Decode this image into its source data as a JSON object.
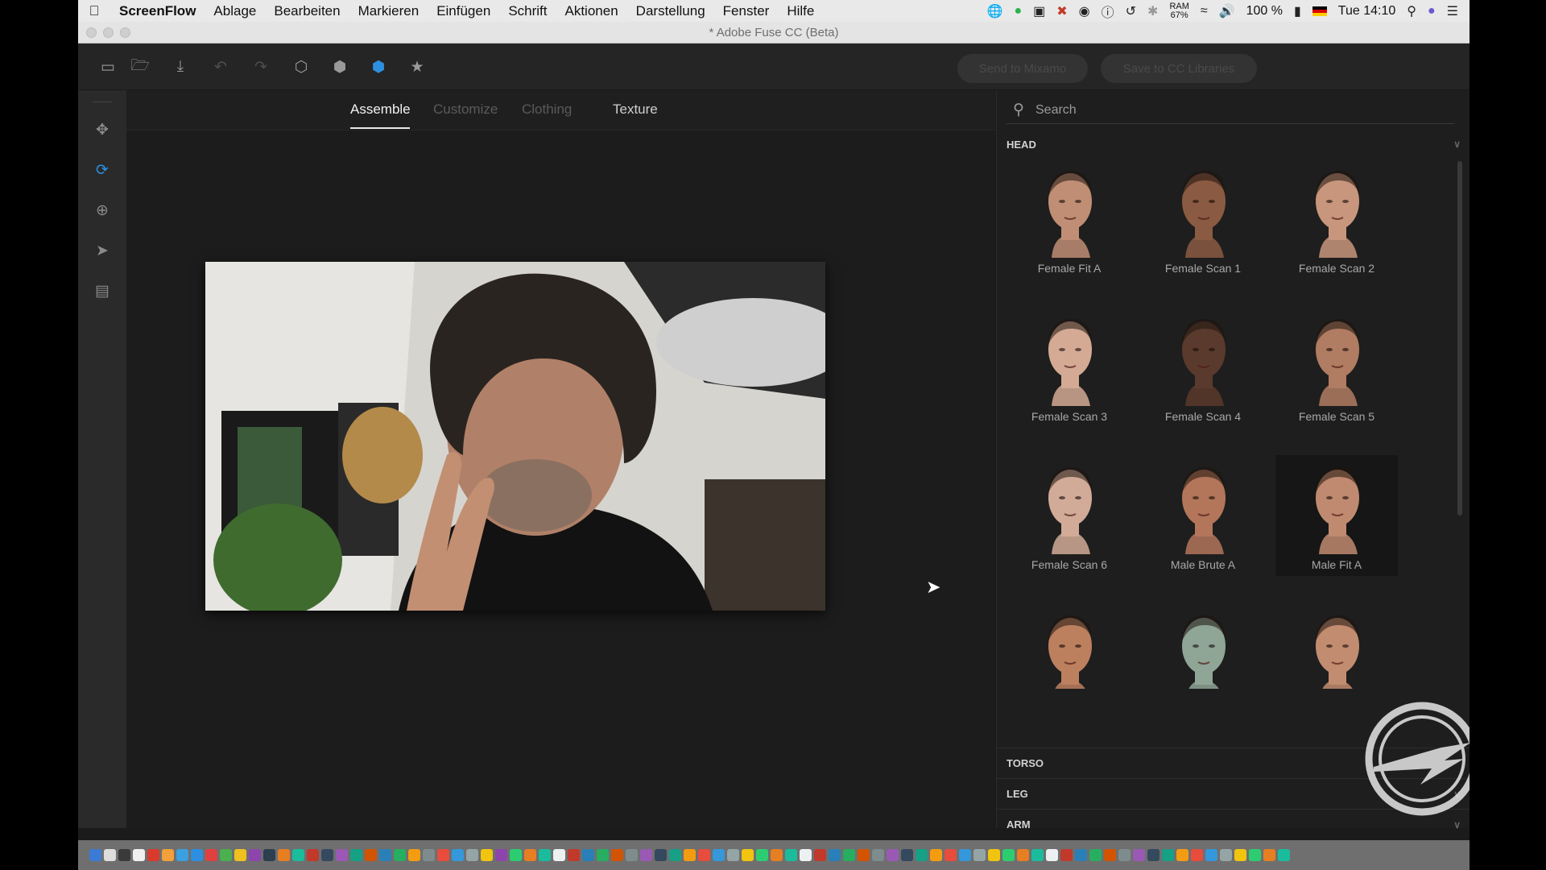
{
  "menubar": {
    "apple": "",
    "items": [
      "ScreenFlow",
      "Ablage",
      "Bearbeiten",
      "Markieren",
      "Einfügen",
      "Schrift",
      "Aktionen",
      "Darstellung",
      "Fenster",
      "Hilfe"
    ],
    "ram_label": "RAM",
    "ram_value": "67%",
    "battery": "100 %",
    "clock": "Tue 14:10"
  },
  "window": {
    "title": "* Adobe Fuse CC (Beta)"
  },
  "toolbar": {
    "send_label": "Send to Mixamo",
    "save_label": "Save to CC Libraries"
  },
  "tabs": [
    "Assemble",
    "Customize",
    "Clothing",
    "Texture"
  ],
  "panel": {
    "search_placeholder": "Search",
    "head_title": "HEAD",
    "heads": [
      {
        "label": "Female Fit A",
        "tone": "#c08e74"
      },
      {
        "label": "Female Scan 1",
        "tone": "#8a5a42"
      },
      {
        "label": "Female Scan 2",
        "tone": "#c8967c"
      },
      {
        "label": "Female Scan 3",
        "tone": "#d4aa94"
      },
      {
        "label": "Female Scan 4",
        "tone": "#5a3a2c"
      },
      {
        "label": "Female Scan 5",
        "tone": "#b07c62"
      },
      {
        "label": "Female Scan 6",
        "tone": "#d2ab98"
      },
      {
        "label": "Male Brute A",
        "tone": "#b3765a"
      },
      {
        "label": "Male Fit A",
        "tone": "#c08a70"
      },
      {
        "label": "",
        "tone": "#bc805f"
      },
      {
        "label": "",
        "tone": "#8fa596"
      },
      {
        "label": "",
        "tone": "#c28c70"
      }
    ],
    "selected_head": "Male Fit A",
    "sections": [
      "TORSO",
      "LEG",
      "ARM"
    ]
  },
  "dock_colors": [
    "#3b7bd6",
    "#ddd",
    "#3a3a3a",
    "#f0f0f0",
    "#d93a2b",
    "#f2a03a",
    "#3aa0e0",
    "#2d8fe0",
    "#e04040",
    "#4caf50",
    "#f0c020",
    "#8e44ad",
    "#2c3e50",
    "#e67e22",
    "#1abc9c",
    "#c0392b",
    "#34495e",
    "#9b59b6",
    "#16a085",
    "#d35400",
    "#2980b9",
    "#27ae60",
    "#f39c12",
    "#7f8c8d",
    "#e74c3c",
    "#3498db",
    "#95a5a6",
    "#f1c40f",
    "#8e44ad",
    "#2ecc71",
    "#e67e22",
    "#1abc9c",
    "#ecf0f1",
    "#c0392b",
    "#2980b9",
    "#27ae60",
    "#d35400",
    "#7f8c8d",
    "#9b59b6",
    "#34495e",
    "#16a085",
    "#f39c12",
    "#e74c3c",
    "#3498db",
    "#95a5a6",
    "#f1c40f",
    "#2ecc71",
    "#e67e22",
    "#1abc9c",
    "#ecf0f1",
    "#c0392b",
    "#2980b9",
    "#27ae60",
    "#d35400",
    "#7f8c8d",
    "#9b59b6",
    "#34495e",
    "#16a085",
    "#f39c12",
    "#e74c3c",
    "#3498db",
    "#95a5a6",
    "#f1c40f",
    "#2ecc71",
    "#e67e22",
    "#1abc9c",
    "#ecf0f1",
    "#c0392b",
    "#2980b9",
    "#27ae60",
    "#d35400",
    "#7f8c8d",
    "#9b59b6",
    "#34495e",
    "#16a085",
    "#f39c12",
    "#e74c3c",
    "#3498db",
    "#95a5a6",
    "#f1c40f",
    "#2ecc71",
    "#e67e22",
    "#1abc9c"
  ],
  "colors": {
    "accent": "#2d8fe0",
    "panel_bg": "#1e1e1e",
    "viewport_bg": "#1c1c1c"
  }
}
